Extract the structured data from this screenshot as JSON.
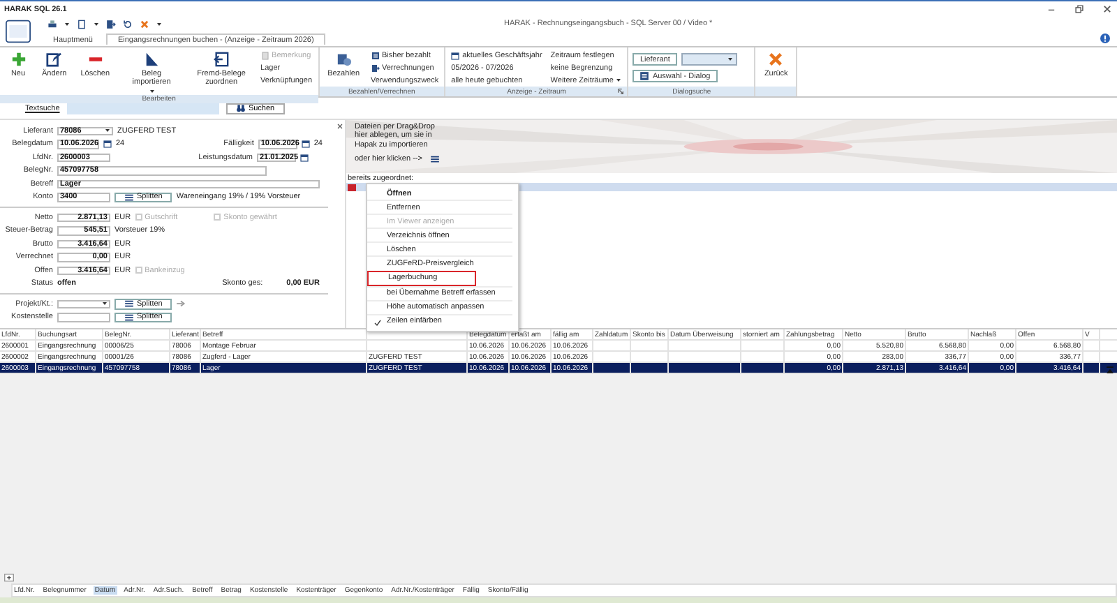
{
  "window": {
    "title": "HARAK SQL 26.1",
    "app_title": "HARAK - Rechnungseingangsbuch - SQL Server 00 / Video *"
  },
  "tabs": [
    {
      "label": "Hauptmenü",
      "selected": false
    },
    {
      "label": "Eingangsrechnungen buchen - (Anzeige - Zeitraum 2026)",
      "selected": true
    }
  ],
  "ribbon": [
    {
      "label": "Bearbeiten",
      "items": [
        {
          "kind": "large",
          "label": "Neu",
          "disabled": false,
          "dropdown": false
        },
        {
          "kind": "large",
          "label": "Ändern",
          "disabled": false,
          "dropdown": false
        },
        {
          "kind": "large",
          "label": "Löschen",
          "disabled": false,
          "dropdown": false
        },
        {
          "kind": "large",
          "label": "Beleg importieren",
          "disabled": false,
          "dropdown": true
        },
        {
          "kind": "large",
          "label": "Fremd-Belege zuordnen",
          "disabled": false,
          "dropdown": false
        },
        {
          "kind": "small",
          "label": "Bemerkung",
          "disabled": true,
          "dropdown": false
        },
        {
          "kind": "small",
          "label": "Lager",
          "disabled": false,
          "dropdown": false
        },
        {
          "kind": "small",
          "label": "Verknüpfungen",
          "disabled": false,
          "dropdown": false
        }
      ]
    },
    {
      "label": "Bezahlen/Verrechnen",
      "items": [
        {
          "kind": "large",
          "label": "Bezahlen",
          "disabled": false,
          "dropdown": false
        },
        {
          "kind": "small",
          "label": "Bisher bezahlt",
          "disabled": false,
          "dropdown": false
        },
        {
          "kind": "small",
          "label": "Verrechnungen",
          "disabled": false,
          "dropdown": false
        },
        {
          "kind": "small",
          "label": "Verwendungszweck",
          "disabled": false,
          "dropdown": false
        }
      ]
    },
    {
      "label": "Anzeige - Zeitraum",
      "launcher": true,
      "items": [
        {
          "kind": "small",
          "label": "aktuelles Geschäftsjahr",
          "disabled": false,
          "dropdown": false
        },
        {
          "kind": "small",
          "label": "05/2026 - 07/2026",
          "disabled": false,
          "dropdown": false
        },
        {
          "kind": "small",
          "label": "alle heute gebuchten",
          "disabled": false,
          "dropdown": false
        },
        {
          "kind": "small",
          "label": "Zeitraum festlegen",
          "disabled": false,
          "dropdown": false
        },
        {
          "kind": "small",
          "label": "keine Begrenzung",
          "disabled": false,
          "dropdown": false
        },
        {
          "kind": "small",
          "label": "Weitere Zeiträume",
          "disabled": false,
          "dropdown": true
        }
      ]
    },
    {
      "label": "Dialogsuche",
      "items": [
        {
          "kind": "button",
          "label": "Lieferant",
          "disabled": false,
          "dropdown": false
        },
        {
          "kind": "combo",
          "disabled": false,
          "dropdown": true
        },
        {
          "kind": "button",
          "label": "Auswahl - Dialog",
          "disabled": false,
          "dropdown": false
        }
      ]
    },
    {
      "items": [
        {
          "kind": "large",
          "label": "Zurück",
          "disabled": false,
          "dropdown": false
        }
      ]
    }
  ],
  "search": {
    "label": "Textsuche",
    "button": "Suchen"
  },
  "form": {
    "lieferant": {
      "label": "Lieferant",
      "value": "78086",
      "name": "ZUGFERD TEST"
    },
    "belegdatum": {
      "label": "Belegdatum",
      "value": "10.06.2026",
      "days": "24"
    },
    "faelligkeit": {
      "label": "Fälligkeit",
      "value": "10.06.2026",
      "days": "24"
    },
    "lfdnr": {
      "label": "LfdNr.",
      "value": "2600003"
    },
    "leistungsdatum": {
      "label": "Leistungsdatum",
      "value": "21.01.2025"
    },
    "belegnr": {
      "label": "BelegNr.",
      "value": "457097758"
    },
    "betreff": {
      "label": "Betreff",
      "value": "Lager"
    },
    "konto": {
      "label": "Konto",
      "value": "3400",
      "button": "Splitten",
      "description": "Wareneingang 19% / 19% Vorsteuer"
    },
    "skonto_gewaehrt": {
      "label": "Skonto gewährt",
      "checked": false,
      "disabled": true
    },
    "amounts": [
      {
        "label": "Netto",
        "value": "2.871,13",
        "unit": "EUR",
        "checkbox": {
          "label": "Gutschrift",
          "checked": false,
          "disabled": true
        }
      },
      {
        "label": "Steuer-Betrag",
        "value": "545,51",
        "unit": "Vorsteuer 19%"
      },
      {
        "label": "Brutto",
        "value": "3.416,64",
        "unit": "EUR"
      },
      {
        "label": "Verrechnet",
        "value": "0,00",
        "unit": "EUR"
      },
      {
        "label": "Offen",
        "value": "3.416,64",
        "unit": "EUR",
        "checkbox": {
          "label": "Bankeinzug",
          "checked": false,
          "disabled": true
        }
      }
    ],
    "status": {
      "label": "Status",
      "value": "offen"
    },
    "skonto": {
      "label": "Skonto ges:",
      "value": "0,00 EUR"
    },
    "projekt": {
      "label": "Projekt/Kt.:",
      "button": "Splitten"
    },
    "kostenstelle": {
      "label": "Kostenstelle",
      "button": "Splitten"
    }
  },
  "dropzone": {
    "hint": "Dateien per Drag&Drop hier ablegen, um sie in Hapak zu importieren",
    "click_label": "oder hier klicken -->",
    "assigned_label": "bereits zugeordnet:",
    "files": [
      {
        "selected": true
      }
    ]
  },
  "context_menu": [
    {
      "label": "Öffnen",
      "default": true,
      "disabled": false,
      "checked": false,
      "highlighted": false
    },
    {
      "label": "Entfernen",
      "default": false,
      "disabled": false,
      "checked": false,
      "highlighted": false
    },
    {
      "label": "Im Viewer anzeigen",
      "default": false,
      "disabled": true,
      "checked": false,
      "highlighted": false
    },
    {
      "label": "Verzeichnis öffnen",
      "default": false,
      "disabled": false,
      "checked": false,
      "highlighted": false
    },
    {
      "label": "Löschen",
      "default": false,
      "disabled": false,
      "checked": false,
      "highlighted": false
    },
    {
      "label": "ZUGFeRD-Preisvergleich",
      "default": false,
      "disabled": false,
      "checked": false,
      "highlighted": false
    },
    {
      "label": "Lagerbuchung",
      "default": false,
      "disabled": false,
      "checked": false,
      "highlighted": true
    },
    {
      "label": "bei Übernahme Betreff erfassen",
      "default": false,
      "disabled": false,
      "checked": false,
      "highlighted": false
    },
    {
      "label": "Höhe automatisch anpassen",
      "default": false,
      "disabled": false,
      "checked": false,
      "highlighted": false
    },
    {
      "label": "Zeilen einfärben",
      "default": false,
      "disabled": false,
      "checked": true,
      "highlighted": false
    }
  ],
  "table": {
    "columns": [
      "LfdNr.",
      "Buchungsart",
      "BelegNr.",
      "Lieferant",
      "Betreff",
      null,
      "Belegdatum",
      "erfaßt am",
      "fällig am",
      "Zahldatum",
      "Skonto bis",
      "Datum Überweisung",
      "storniert am",
      "Zahlungsbetrag",
      "Netto",
      "Brutto",
      "Nachlaß",
      "Offen",
      "V"
    ],
    "rows": [
      {
        "selected": false,
        "cells": [
          "2600001",
          "Eingangsrechnung",
          "00006/25",
          "78006",
          "Montage Februar",
          null,
          "10.06.2026",
          "10.06.2026",
          "10.06.2026",
          null,
          null,
          null,
          null,
          "0,00",
          "5.520,80",
          "6.568,80",
          "0,00",
          "6.568,80",
          null
        ]
      },
      {
        "selected": false,
        "cells": [
          "2600002",
          "Eingangsrechnung",
          "00001/26",
          "78086",
          "Zugferd - Lager",
          "ZUGFERD TEST",
          "10.06.2026",
          "10.06.2026",
          "10.06.2026",
          null,
          null,
          null,
          null,
          "0,00",
          "283,00",
          "336,77",
          "0,00",
          "336,77",
          null
        ]
      },
      {
        "selected": true,
        "cells": [
          "2600003",
          "Eingangsrechnung",
          "457097758",
          "78086",
          "Lager",
          "ZUGFERD TEST",
          "10.06.2026",
          "10.06.2026",
          "10.06.2026",
          null,
          null,
          null,
          null,
          "0,00",
          "2.871,13",
          "3.416,64",
          "0,00",
          "3.416,64",
          null
        ]
      }
    ]
  },
  "field_chooser": [
    {
      "label": "Lfd.Nr.",
      "selected": false
    },
    {
      "label": "Belegnummer",
      "selected": false
    },
    {
      "label": "Datum",
      "selected": true
    },
    {
      "label": "Adr.Nr.",
      "selected": false
    },
    {
      "label": "Adr.Such.",
      "selected": false
    },
    {
      "label": "Betreff",
      "selected": false
    },
    {
      "label": "Betrag",
      "selected": false
    },
    {
      "label": "Kostenstelle",
      "selected": false
    },
    {
      "label": "Kostenträger",
      "selected": false
    },
    {
      "label": "Gegenkonto",
      "selected": false
    },
    {
      "label": "Adr.Nr./Kostenträger",
      "selected": false
    },
    {
      "label": "Fällig",
      "selected": false
    },
    {
      "label": "Skonto/Fällig",
      "selected": false
    }
  ]
}
